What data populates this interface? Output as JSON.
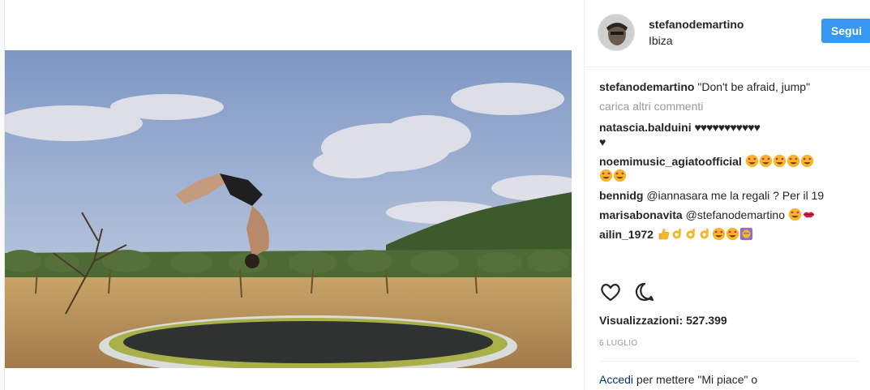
{
  "post": {
    "username": "stefanodemartino",
    "location": "Ibiza",
    "follow_label": "Segui",
    "caption": {
      "user": "stefanodemartino",
      "text": "\"Don't be afraid, jump\""
    },
    "load_more": "carica altri commenti",
    "comments": [
      {
        "user": "natascia.balduini",
        "text": "",
        "hearts": "♥♥♥♥♥♥♥♥♥♥♥",
        "hearts2": "♥"
      },
      {
        "user": "noemimusic_agiatoofficial",
        "text": "",
        "emoji": [
          "heart-eyes",
          "heart-eyes",
          "heart-eyes",
          "heart-eyes",
          "heart-eyes",
          "heart-eyes",
          "heart-eyes"
        ]
      },
      {
        "user": "bennidg",
        "text": "@iannasara me la regali ? Per il 19"
      },
      {
        "user": "marisabonavita",
        "text": "@stefanodemartino",
        "emoji": [
          "heart-eyes",
          "lips"
        ]
      },
      {
        "user": "ailin_1972",
        "text": "",
        "emoji": [
          "thumbs-up",
          "ok-hand",
          "ok-hand",
          "ok-hand",
          "heart-eyes",
          "heart-eyes",
          "raised-hands"
        ]
      }
    ],
    "views_label": "Visualizzazioni:",
    "views_count": "527.399",
    "date": "6 LUGLIO",
    "login_link": "Accedi",
    "login_text": "per mettere \"Mi piace\" o"
  },
  "icons": {
    "like": "heart-outline-icon",
    "comment": "comment-bubble-icon"
  },
  "colors": {
    "accent": "#3897f0",
    "text": "#262626",
    "muted": "#999999"
  }
}
